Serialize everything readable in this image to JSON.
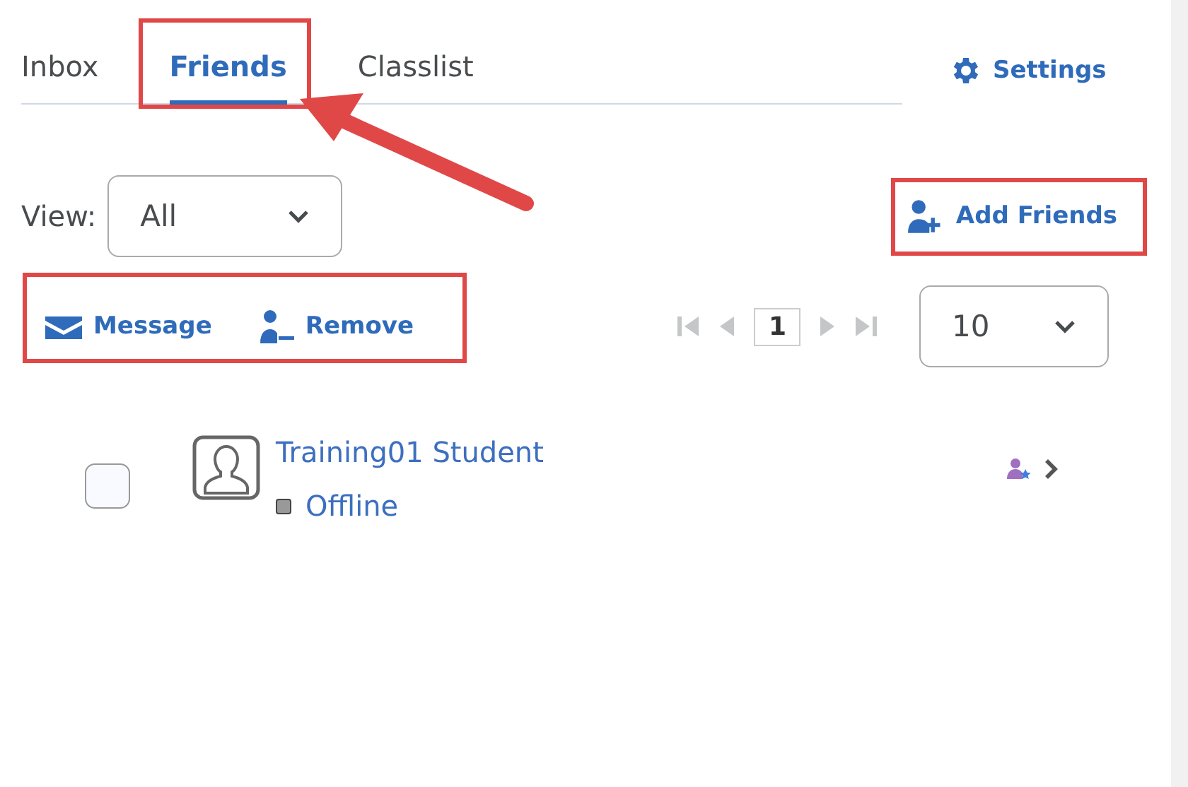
{
  "tabs": [
    {
      "label": "Inbox",
      "selected": false
    },
    {
      "label": "Friends",
      "selected": true
    },
    {
      "label": "Classlist",
      "selected": false
    }
  ],
  "settings": {
    "label": "Settings"
  },
  "view": {
    "label": "View:",
    "value": "All"
  },
  "add_friends": {
    "label": "Add Friends"
  },
  "actions": [
    {
      "kind": "message",
      "label": "Message"
    },
    {
      "kind": "remove",
      "label": "Remove"
    }
  ],
  "pager": {
    "page": "1",
    "nav_disabled": true
  },
  "page_size": {
    "value": "10"
  },
  "friends": [
    {
      "name": "Training01 Student",
      "status": "Offline",
      "checked": false
    }
  ]
}
